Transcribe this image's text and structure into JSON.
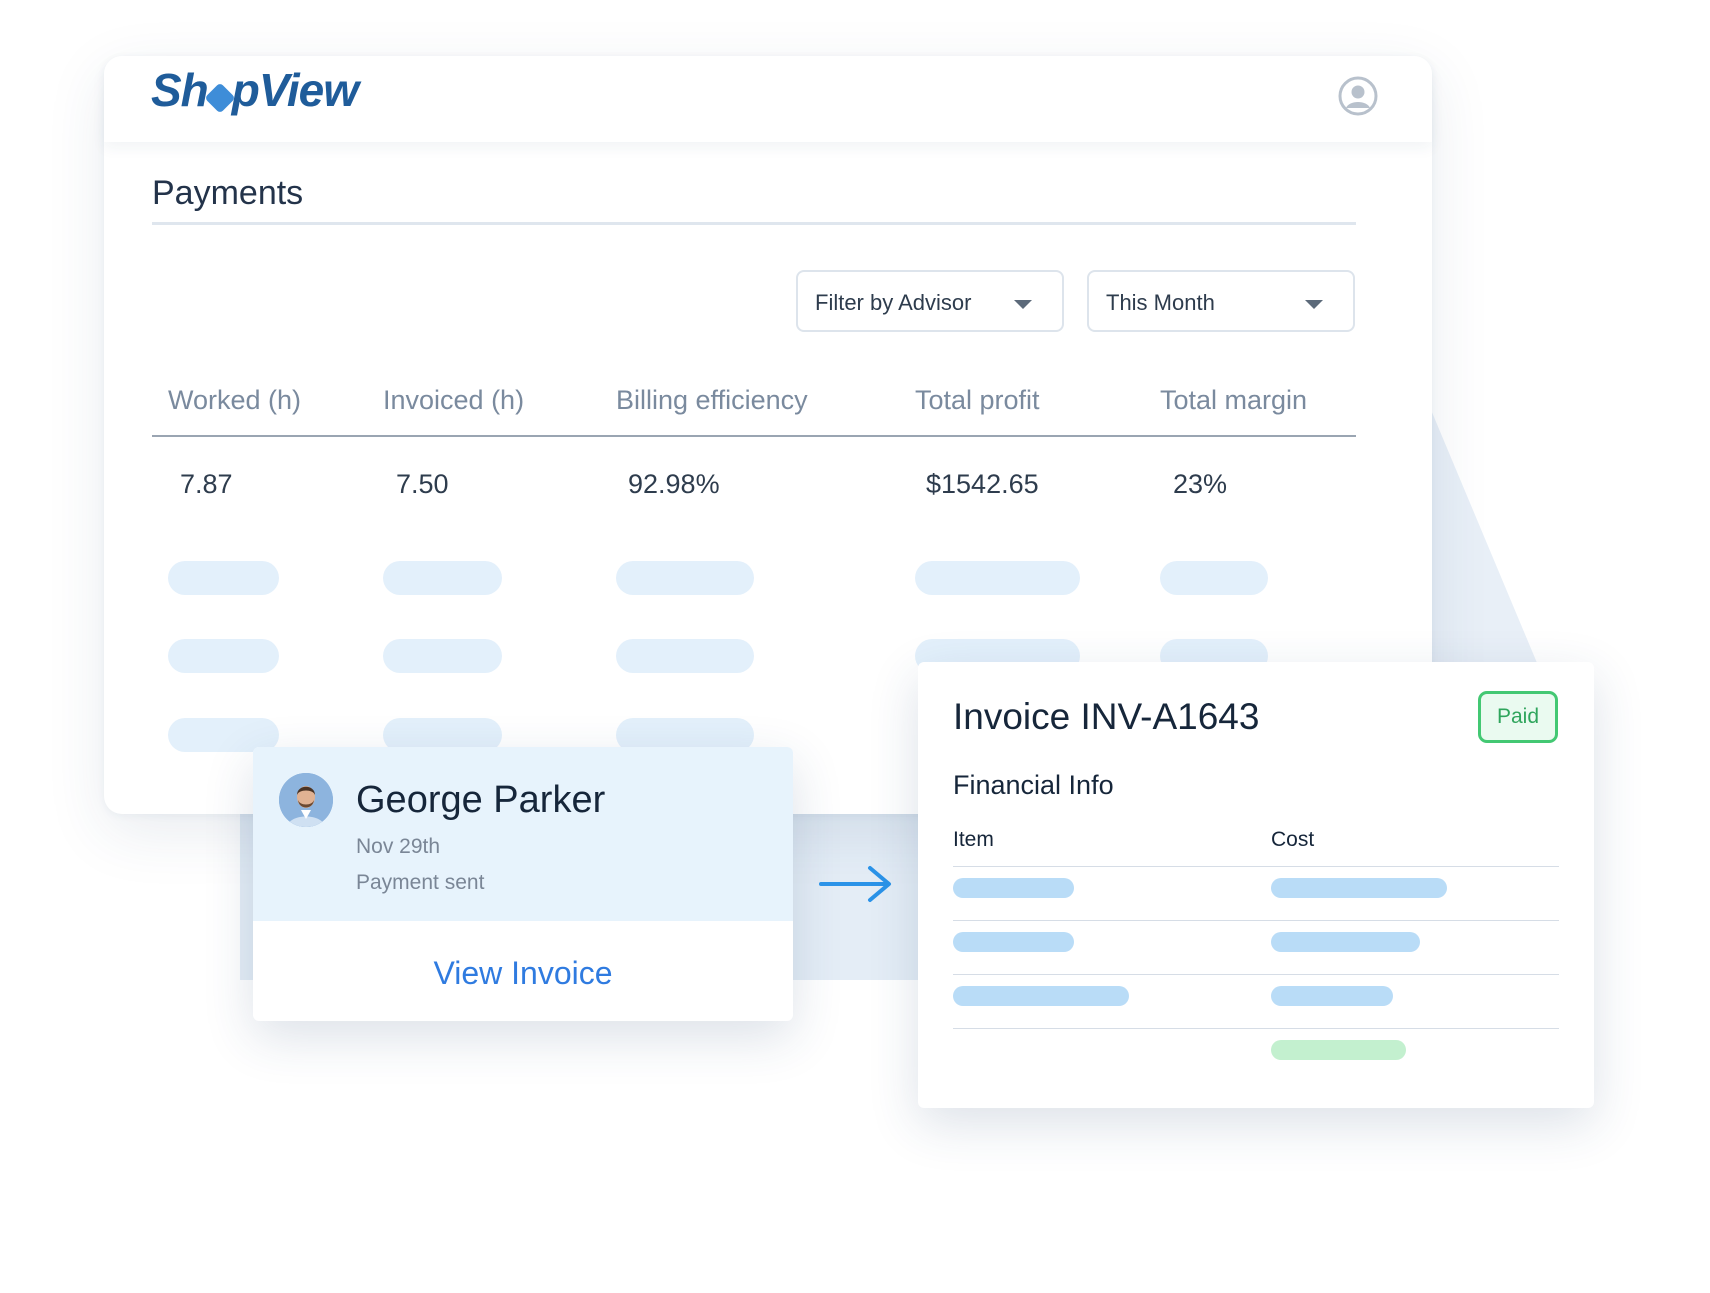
{
  "app": {
    "logo_text_1": "Sh",
    "logo_text_2": "pView"
  },
  "page": {
    "title": "Payments"
  },
  "filters": {
    "advisor_label": "Filter by Advisor",
    "period_label": "This Month"
  },
  "table": {
    "columns": [
      "Worked (h)",
      "Invoiced (h)",
      "Billing efficiency",
      "Total profit",
      "Total margin"
    ],
    "row": [
      "7.87",
      "7.50",
      "92.98%",
      "$1542.65",
      "23%"
    ]
  },
  "payment_card": {
    "name": "George Parker",
    "date": "Nov 29th",
    "status": "Payment sent",
    "link_label": "View Invoice"
  },
  "invoice": {
    "title": "Invoice INV-A1643",
    "status": "Paid",
    "section_label": "Financial Info",
    "columns": [
      "Item",
      "Cost"
    ]
  },
  "colors": {
    "brand": "#1f5c9a",
    "link": "#2f7be0",
    "paid": "#43c873",
    "placeholder": "#e3f0fb"
  },
  "icons": {
    "user": "user-circle-icon",
    "arrow": "arrow-right-icon",
    "caret": "chevron-down-icon"
  }
}
